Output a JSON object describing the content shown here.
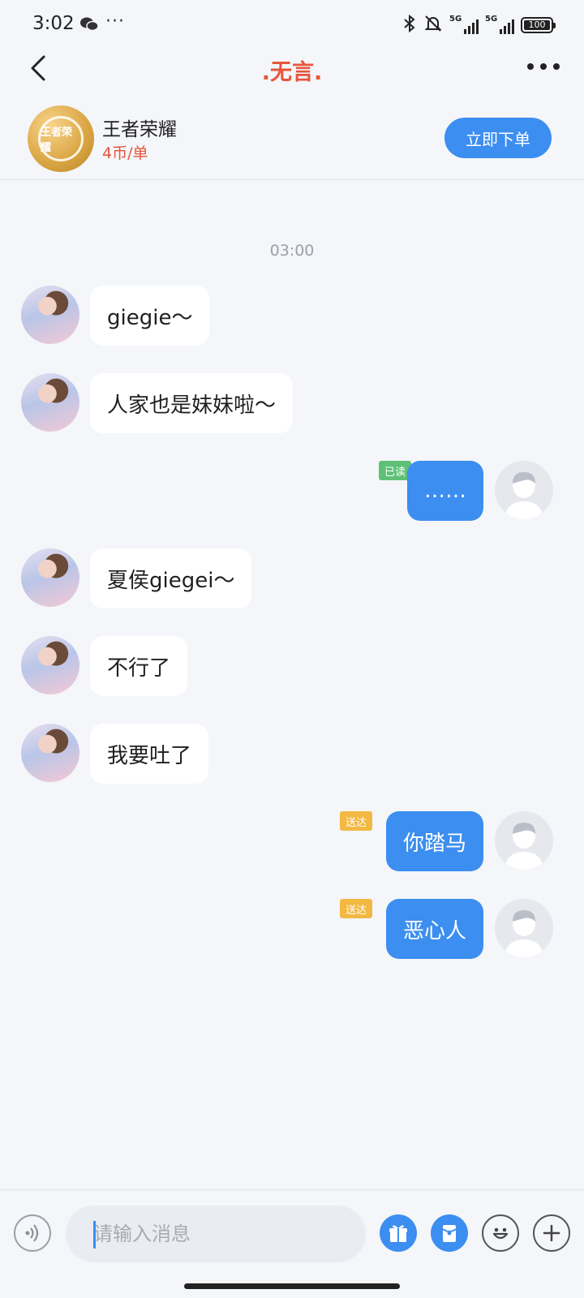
{
  "status_bar": {
    "time": "3:02",
    "extra": "···",
    "net1": "5G",
    "net2": "5G",
    "battery": "100"
  },
  "nav": {
    "title": ".无言."
  },
  "game": {
    "name": "王者荣耀",
    "price": "4币/单",
    "logo_text": "王者荣耀",
    "order_label": "立即下单"
  },
  "chat": {
    "timestamp": "03:00",
    "messages": [
      {
        "side": "in",
        "text": "giegie～"
      },
      {
        "side": "in",
        "text": "人家也是妹妹啦～"
      },
      {
        "side": "out",
        "text": "……",
        "status": "已读"
      },
      {
        "side": "in",
        "text": "夏侯giegei～"
      },
      {
        "side": "in",
        "text": "不行了"
      },
      {
        "side": "in",
        "text": "我要吐了"
      },
      {
        "side": "out",
        "text": "你踏马",
        "status": "送达"
      },
      {
        "side": "out",
        "text": "恶心人",
        "status": "送达"
      }
    ]
  },
  "input": {
    "placeholder": "请输入消息",
    "value": ""
  },
  "colors": {
    "accent": "#3c8ef0",
    "title_red": "#e8543c",
    "read_tag": "#5ec075",
    "sent_tag": "#f2b842"
  },
  "icons": [
    "back-icon",
    "more-icon",
    "voice-icon",
    "gift-icon",
    "red-packet-icon",
    "emoji-icon",
    "plus-icon",
    "bluetooth-icon",
    "mute-icon",
    "wechat-icon"
  ]
}
